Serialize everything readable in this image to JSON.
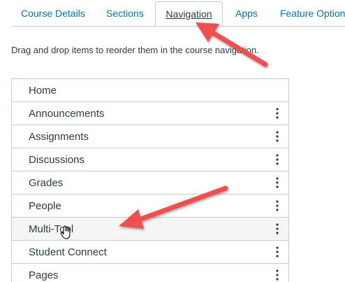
{
  "tabs": [
    {
      "label": "Course Details"
    },
    {
      "label": "Sections"
    },
    {
      "label": "Navigation"
    },
    {
      "label": "Apps"
    },
    {
      "label": "Feature Option"
    }
  ],
  "active_tab": "Navigation",
  "instruction": "Drag and drop items to reorder them in the course navigation.",
  "nav_items": [
    {
      "label": "Home"
    },
    {
      "label": "Announcements"
    },
    {
      "label": "Assignments"
    },
    {
      "label": "Discussions"
    },
    {
      "label": "Grades"
    },
    {
      "label": "People"
    },
    {
      "label": "Multi-Tool"
    },
    {
      "label": "Student Connect"
    },
    {
      "label": "Pages"
    }
  ],
  "colors": {
    "link": "#0374b5",
    "text": "#2d3b45",
    "border": "#c7cdd1",
    "annotation_arrow": "#ef4f4f"
  },
  "icons": {
    "item_menu": "kebab-menu-icon",
    "cursor": "grab-hand-cursor-icon"
  }
}
